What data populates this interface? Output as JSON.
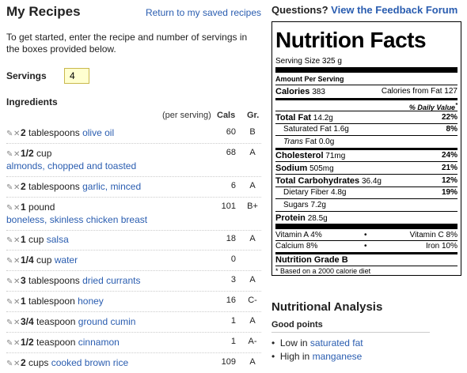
{
  "page": {
    "title": "My Recipes",
    "return_link": "Return to my saved recipes",
    "intro": "To get started, enter the recipe and number of servings in the boxes provided below.",
    "servings_label": "Servings",
    "servings_value": "4",
    "ingredients_label": "Ingredients",
    "col_per_serving": "(per serving)",
    "col_cals": "Cals",
    "col_grade": "Gr."
  },
  "ingredients": [
    {
      "qty": "2",
      "unit": "tablespoons",
      "name": "olive oil",
      "cals": "60",
      "grade": "B"
    },
    {
      "qty": "1/2",
      "unit": "cup",
      "name": "almonds, chopped and toasted",
      "cals": "68",
      "grade": "A"
    },
    {
      "qty": "2",
      "unit": "tablespoons",
      "name": "garlic, minced",
      "cals": "6",
      "grade": "A"
    },
    {
      "qty": "1",
      "unit": "pound",
      "name": "boneless, skinless chicken breast",
      "cals": "101",
      "grade": "B+"
    },
    {
      "qty": "1",
      "unit": "cup",
      "name": "salsa",
      "cals": "18",
      "grade": "A"
    },
    {
      "qty": "1/4",
      "unit": "cup",
      "name": "water",
      "cals": "0",
      "grade": ""
    },
    {
      "qty": "3",
      "unit": "tablespoons",
      "name": "dried currants",
      "cals": "3",
      "grade": "A"
    },
    {
      "qty": "1",
      "unit": "tablespoon",
      "name": "honey",
      "cals": "16",
      "grade": "C-"
    },
    {
      "qty": "3/4",
      "unit": "teaspoon",
      "name": "ground cumin",
      "cals": "1",
      "grade": "A"
    },
    {
      "qty": "1/2",
      "unit": "teaspoon",
      "name": "cinnamon",
      "cals": "1",
      "grade": "A-"
    },
    {
      "qty": "2",
      "unit": "cups",
      "name": "cooked brown rice",
      "cals": "109",
      "grade": "A"
    }
  ],
  "feedback": {
    "question": "Questions?",
    "link": "View the Feedback Forum"
  },
  "nutrition": {
    "title": "Nutrition Facts",
    "serving_size_label": "Serving Size",
    "serving_size": "325 g",
    "amount_per_serving": "Amount Per Serving",
    "calories_label": "Calories",
    "calories": "383",
    "calories_fat": "Calories from Fat 127",
    "daily_value": "% Daily Value",
    "daily_value_star": "*",
    "total_fat_label": "Total Fat",
    "total_fat": "14.2g",
    "total_fat_pct": "22%",
    "sat_fat_label": "Saturated Fat",
    "sat_fat": "1.6g",
    "sat_fat_pct": "8%",
    "trans_fat_label": "Trans",
    "trans_fat_suffix": "Fat",
    "trans_fat": "0.0g",
    "cholesterol_label": "Cholesterol",
    "cholesterol": "71mg",
    "cholesterol_pct": "24%",
    "sodium_label": "Sodium",
    "sodium": "505mg",
    "sodium_pct": "21%",
    "carbs_label": "Total Carbohydrates",
    "carbs": "36.4g",
    "carbs_pct": "12%",
    "fiber_label": "Dietary Fiber",
    "fiber": "4.8g",
    "fiber_pct": "19%",
    "sugars_label": "Sugars",
    "sugars": "7.2g",
    "protein_label": "Protein",
    "protein": "28.5g",
    "vit_a": "Vitamin A 4%",
    "vit_c": "Vitamin C 8%",
    "calcium": "Calcium 8%",
    "iron": "Iron 10%",
    "bullet": "•",
    "grade": "Nutrition Grade B",
    "footnote": "* Based on a 2000 calorie diet"
  },
  "analysis": {
    "title": "Nutritional Analysis",
    "good_points_label": "Good points",
    "good_points": [
      {
        "prefix": "Low in",
        "link": "saturated fat"
      },
      {
        "prefix": "High in",
        "link": "manganese"
      }
    ]
  },
  "icons": {
    "edit": "pencil-icon",
    "remove": "x-icon"
  },
  "colors": {
    "link": "#2a5db0",
    "servings_bg": "#ffffd0"
  }
}
